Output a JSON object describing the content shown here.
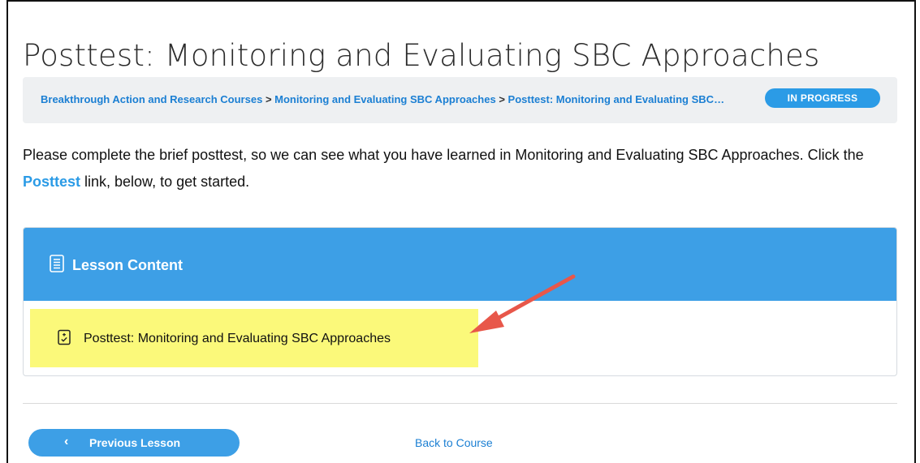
{
  "page": {
    "title": "Posttest: Monitoring and Evaluating SBC Approaches"
  },
  "breadcrumb": {
    "items": [
      "Breakthrough Action and Research Courses",
      "Monitoring and Evaluating SBC Approaches",
      "Posttest: Monitoring and Evaluating SBC Approaches"
    ],
    "separator": ">"
  },
  "status": {
    "label": "IN PROGRESS",
    "color": "#2b9be6"
  },
  "intro": {
    "before_link": "Please complete the brief posttest, so we can see what you have learned in Monitoring and Evaluating SBC Approaches. Click the ",
    "link_text": "Posttest",
    "after_link": " link, below, to get started."
  },
  "lesson_content": {
    "header_title": "Lesson Content",
    "header_icon": "document-list-icon",
    "items": [
      {
        "label": "Posttest: Monitoring and Evaluating SBC Approaches",
        "icon": "quiz-clipboard-icon",
        "highlighted": true
      }
    ]
  },
  "annotation": {
    "arrow_color": "#e8574a",
    "highlight_color": "#fbf97a"
  },
  "navigation": {
    "previous_label": "Previous Lesson",
    "previous_icon": "chevron-left-icon",
    "back_label": "Back to Course"
  },
  "colors": {
    "accent": "#3d9fe6",
    "link": "#1b7fd3"
  }
}
